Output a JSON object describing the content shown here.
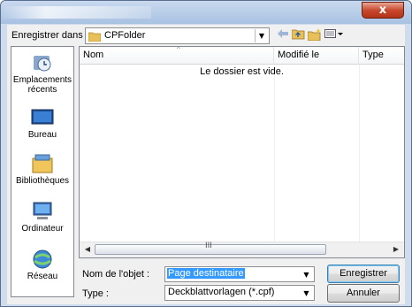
{
  "window": {
    "close_label": "x"
  },
  "toolbar": {
    "save_in_label": "Enregistrer dans :",
    "folder_value": "CPFolder"
  },
  "places": [
    {
      "label": "Emplacements récents",
      "icon": "recent-places-icon"
    },
    {
      "label": "Bureau",
      "icon": "desktop-icon"
    },
    {
      "label": "Bibliothèques",
      "icon": "libraries-icon"
    },
    {
      "label": "Ordinateur",
      "icon": "computer-icon"
    },
    {
      "label": "Réseau",
      "icon": "network-icon"
    }
  ],
  "filelist": {
    "columns": [
      "Nom",
      "Modifié le",
      "Type"
    ],
    "empty_message": "Le dossier est vide.",
    "scroll_grip": "III"
  },
  "form": {
    "filename_label": "Nom de l'objet :",
    "filename_value": "Page destinataire",
    "type_label": "Type :",
    "type_value": "Deckblattvorlagen (*.cpf)",
    "save_button": "Enregistrer",
    "cancel_button": "Annuler"
  },
  "colors": {
    "selection": "#3399ff",
    "close": "#c9492f",
    "title": "#b9cfea"
  }
}
